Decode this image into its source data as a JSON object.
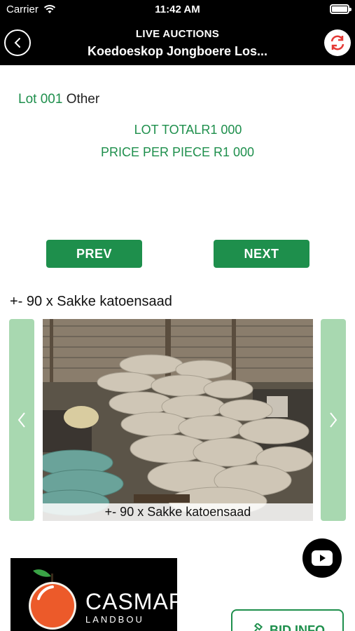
{
  "status": {
    "carrier": "Carrier",
    "time": "11:42 AM"
  },
  "header": {
    "title": "LIVE AUCTIONS",
    "subtitle": "Koedoeskop Jongboere Los..."
  },
  "lot": {
    "number": "Lot 001",
    "category": "Other",
    "total_label": "LOT TOTAL",
    "total_value": "R1 000",
    "price_label": "PRICE PER PIECE",
    "price_value": "R1 000"
  },
  "buttons": {
    "prev": "PREV",
    "next": "NEXT",
    "bid_info": "BID INFO"
  },
  "item": {
    "title": "+- 90 x Sakke katoensaad",
    "caption": "+- 90 x Sakke katoensaad"
  },
  "logo": {
    "name": "CASMAR",
    "sub": "LANDBOU"
  },
  "colors": {
    "accent": "#1e8f4c",
    "arrow_bg": "#a8d8b0",
    "header_bg": "#000000",
    "refresh": "#e53935"
  },
  "icons": [
    "wifi-icon",
    "battery-icon",
    "back-icon",
    "refresh-icon",
    "chevron-left-icon",
    "chevron-right-icon",
    "youtube-icon",
    "gavel-icon"
  ]
}
